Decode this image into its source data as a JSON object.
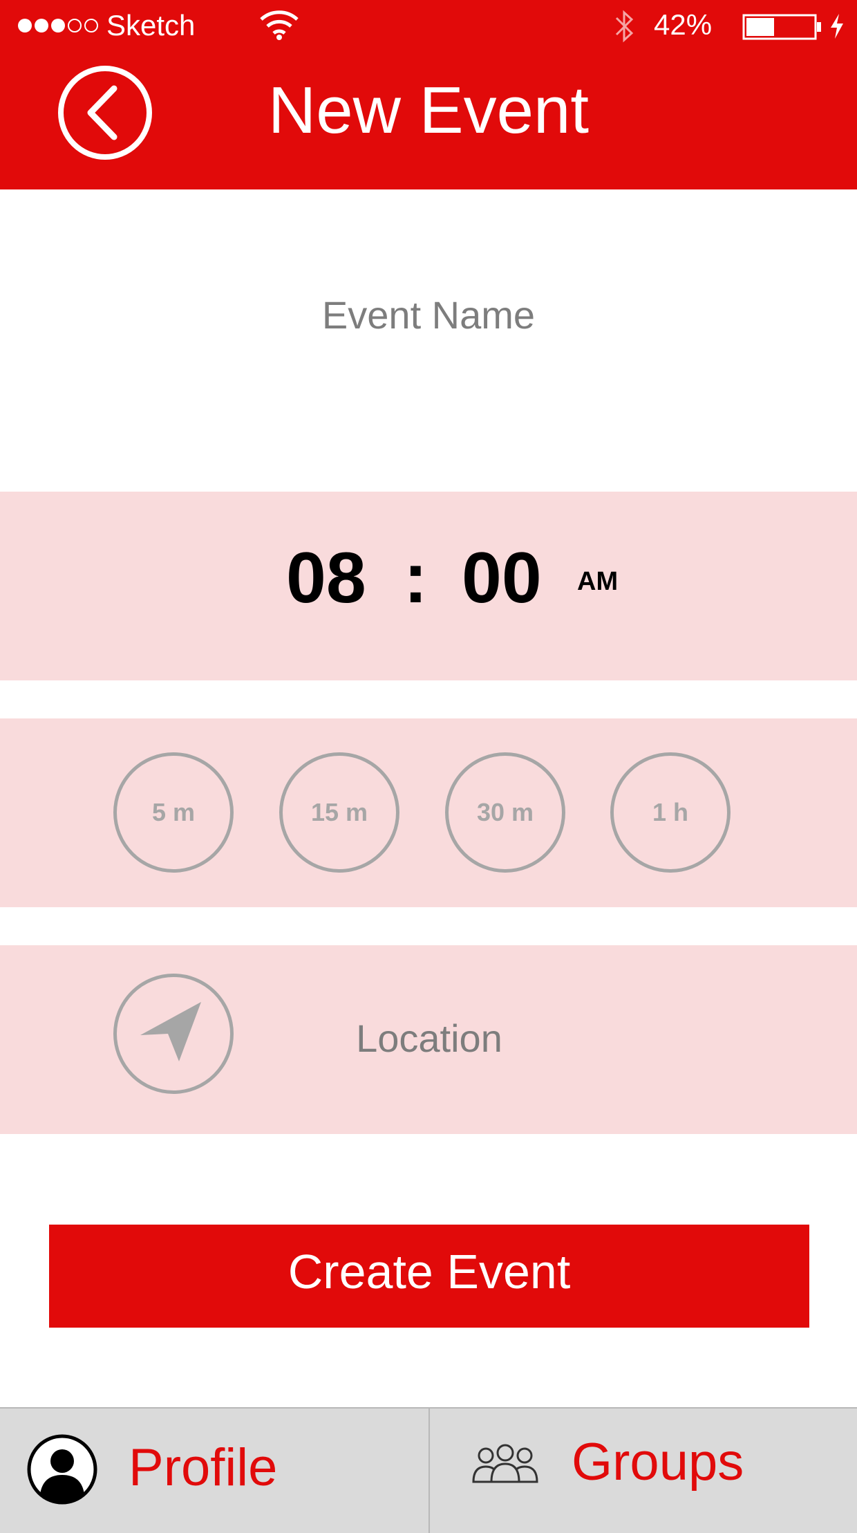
{
  "status_bar": {
    "signal_dots_filled": 3,
    "signal_dots_total": 5,
    "carrier": "Sketch",
    "battery_percent": "42%",
    "battery_level": 0.42
  },
  "header": {
    "title": "New Event",
    "back_icon": "chevron-left-circle-icon"
  },
  "form": {
    "event_name_placeholder": "Event Name",
    "time": {
      "hours": "08",
      "separator": ":",
      "minutes": "00",
      "period": "AM"
    },
    "durations": [
      "5 m",
      "15 m",
      "30 m",
      "1 h"
    ],
    "location_placeholder": "Location",
    "location_icon": "navigation-arrow-icon",
    "create_button": "Create Event"
  },
  "tab_bar": {
    "profile_label": "Profile",
    "groups_label": "Groups"
  },
  "colors": {
    "brand_red": "#e10a0a",
    "band_pink": "#f9dbdc",
    "muted_gray": "#a6a6a6",
    "tab_background": "#dadada"
  }
}
